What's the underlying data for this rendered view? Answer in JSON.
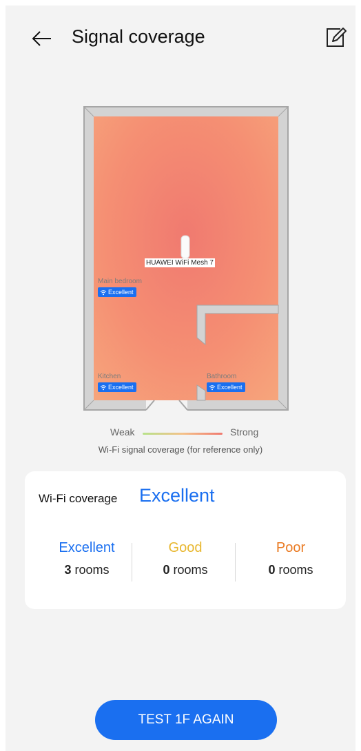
{
  "header": {
    "title": "Signal coverage",
    "back_icon": "back-arrow-icon",
    "edit_icon": "edit-icon"
  },
  "floor_plan": {
    "device_name": "HUAWEI WiFi Mesh 7",
    "rooms": [
      {
        "name": "Main bedroom",
        "status": "Excellent"
      },
      {
        "name": "Kitchen",
        "status": "Excellent"
      },
      {
        "name": "Bathroom",
        "status": "Excellent"
      }
    ]
  },
  "legend": {
    "weak": "Weak",
    "strong": "Strong",
    "note": "Wi-Fi signal coverage (for reference only)"
  },
  "coverage": {
    "label": "Wi-Fi coverage",
    "value": "Excellent",
    "unit": "rooms",
    "stats": [
      {
        "label": "Excellent",
        "count": "3",
        "color": "#1a6ff0"
      },
      {
        "label": "Good",
        "count": "0",
        "color": "#e8b72f"
      },
      {
        "label": "Poor",
        "count": "0",
        "color": "#ea7a22"
      }
    ]
  },
  "action": {
    "label": "TEST 1F AGAIN"
  },
  "colors": {
    "accent": "#1a6ff0",
    "heat_strong": "#f07a70",
    "heat_medium": "#f7a27c"
  }
}
